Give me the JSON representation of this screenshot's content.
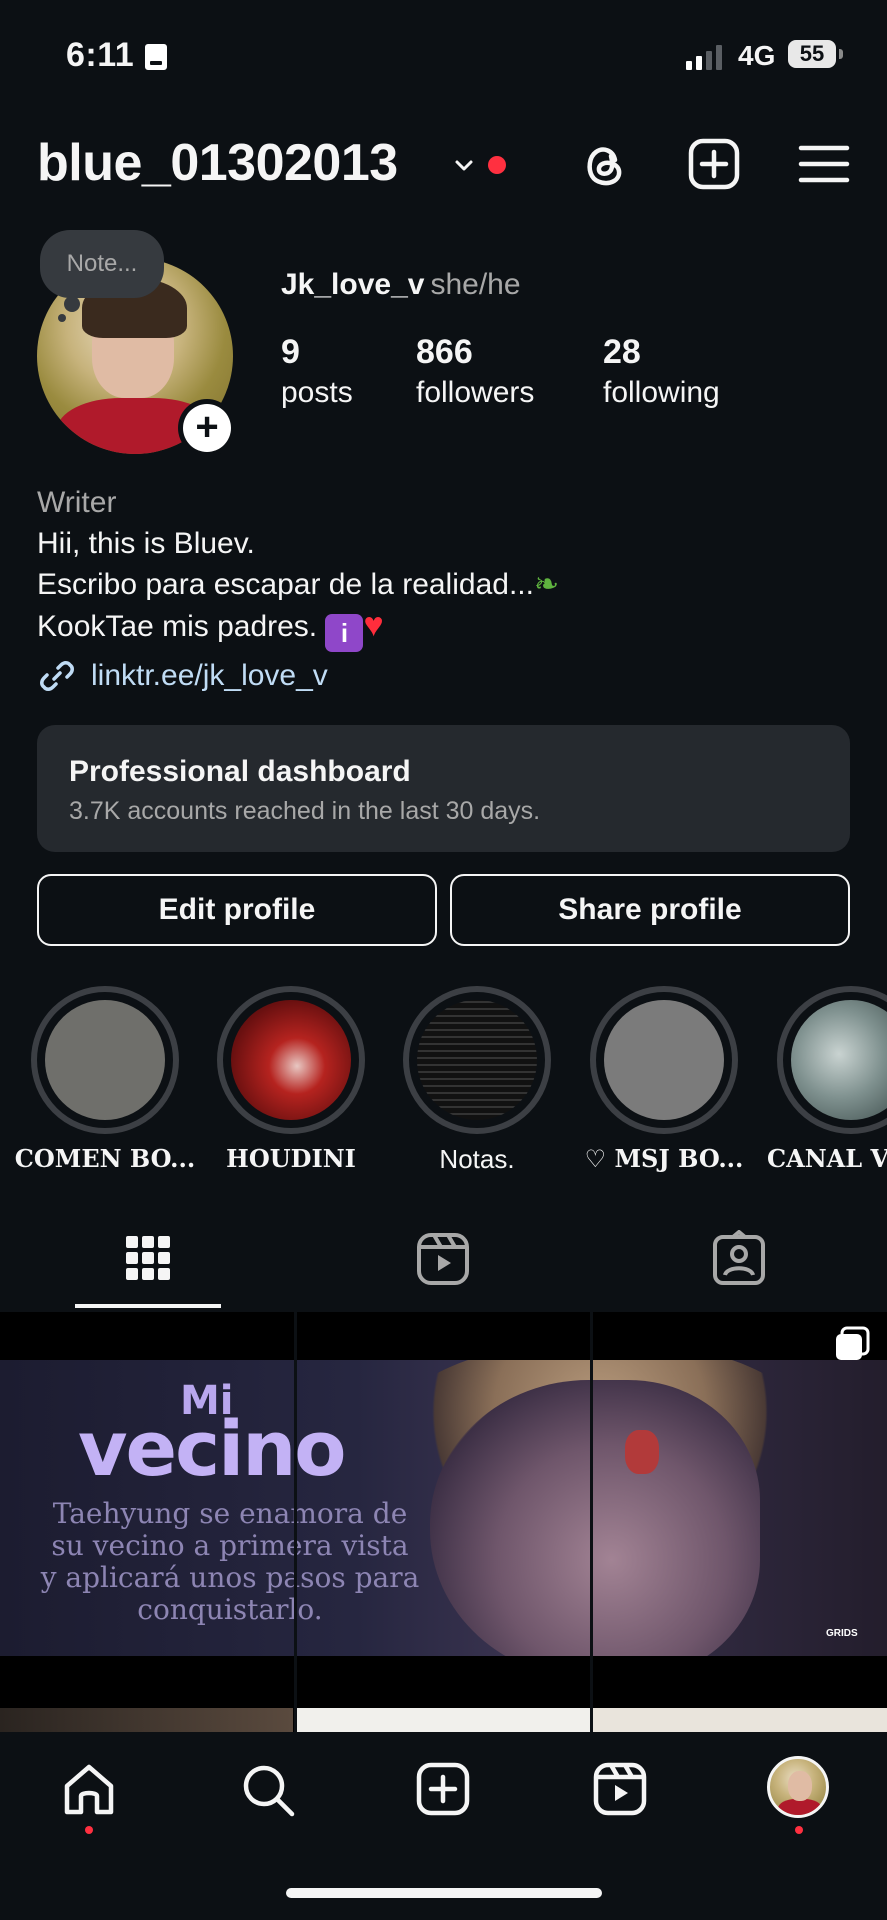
{
  "status_bar": {
    "time": "6:11",
    "network": "4G",
    "battery": "55"
  },
  "header": {
    "username": "blue_01302013"
  },
  "profile": {
    "note_label": "Note...",
    "display_name": "Jk_love_v",
    "pronouns": "she/he",
    "stats": [
      {
        "value": "9",
        "label": "posts"
      },
      {
        "value": "866",
        "label": "followers"
      },
      {
        "value": "28",
        "label": "following"
      }
    ]
  },
  "bio": {
    "category": "Writer",
    "line1": "Hii, this is Bluev.",
    "line2": "Escribo para escapar de la realidad...",
    "line3": "KookTae mis padres.",
    "link": "linktr.ee/jk_love_v"
  },
  "dashboard": {
    "title": "Professional dashboard",
    "subtitle": "3.7K accounts reached in the last 30 days."
  },
  "buttons": {
    "edit": "Edit profile",
    "share": "Share profile"
  },
  "highlights": [
    {
      "label": "COMEN BO..."
    },
    {
      "label": "HOUDINI"
    },
    {
      "label": "Notas."
    },
    {
      "label": "♡ MSJ BO..."
    },
    {
      "label": "CANAL V"
    }
  ],
  "post": {
    "title_small": "Mi",
    "title_big": "vecino",
    "description": "Taehyung se enamora de su vecino a primera vista y aplicará unos pasos para conquistarlo.",
    "watermark": "GRIDS"
  },
  "colors": {
    "background": "#0c1014",
    "accent_red": "#ff3040",
    "link": "#c0dcf5",
    "card": "#25292e"
  }
}
